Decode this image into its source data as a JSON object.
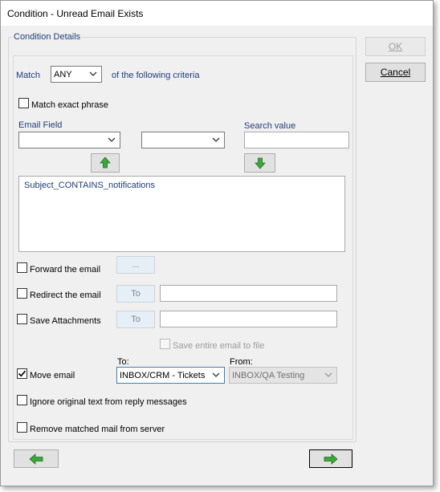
{
  "window": {
    "title": "Condition - Unread Email  Exists"
  },
  "group": {
    "legend": "Condition Details"
  },
  "match": {
    "label": "Match",
    "value": "ANY",
    "suffix": "of the following criteria"
  },
  "match_exact": {
    "label": "Match exact phrase",
    "checked": false
  },
  "email_field": {
    "label": "Email Field",
    "value": ""
  },
  "operator": {
    "value": ""
  },
  "search": {
    "label": "Search value",
    "value": ""
  },
  "criteria_list": [
    "Subject_CONTAINS_notifications"
  ],
  "forward": {
    "label": "Forward the email",
    "checked": false,
    "button": "..."
  },
  "redirect": {
    "label": "Redirect the email",
    "checked": false,
    "button": "To",
    "value": ""
  },
  "save_attachments": {
    "label": "Save Attachments",
    "checked": false,
    "button": "To",
    "value": ""
  },
  "save_entire": {
    "label": "Save entire email to file",
    "checked": false
  },
  "move": {
    "label": "Move email",
    "checked": true,
    "to_label": "To:",
    "to_value": "INBOX/CRM - Tickets",
    "from_label": "From:",
    "from_value": "INBOX/QA Testing"
  },
  "ignore_original": {
    "label": "Ignore original text from reply messages",
    "checked": false
  },
  "remove_matched": {
    "label": "Remove matched mail from server",
    "checked": false
  },
  "buttons": {
    "ok": "OK",
    "cancel": "Cancel"
  },
  "icons": {
    "up": "arrow-up-icon",
    "down": "arrow-down-icon",
    "back": "arrow-left-icon",
    "next": "arrow-right-icon",
    "accent_green": "#3aa83a"
  }
}
